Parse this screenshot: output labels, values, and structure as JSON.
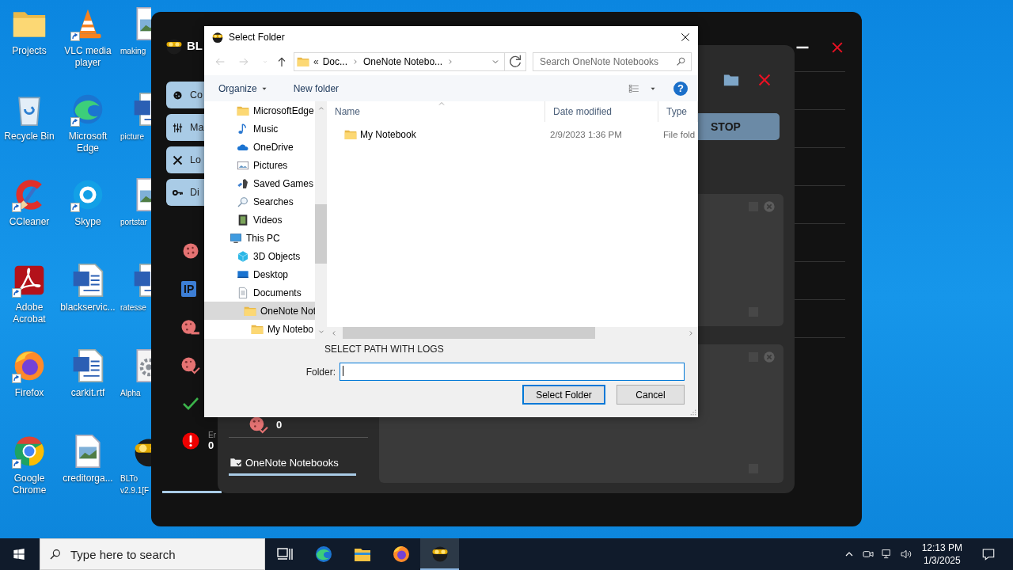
{
  "desktop_icons": [
    {
      "label": "Projects",
      "kind": "folder",
      "shortcut": false
    },
    {
      "label": "VLC media player",
      "kind": "cone",
      "shortcut": true
    },
    {
      "label": "making",
      "kind": "imagefile",
      "shortcut": false
    },
    {
      "label": "Recycle Bin",
      "kind": "bin",
      "shortcut": false
    },
    {
      "label": "Microsoft Edge",
      "kind": "swirl",
      "shortcut": true
    },
    {
      "label": "picture",
      "kind": "worddoc",
      "shortcut": false
    },
    {
      "label": "CCleaner",
      "kind": "ccleaner",
      "shortcut": true
    },
    {
      "label": "Skype",
      "kind": "skype",
      "shortcut": true
    },
    {
      "label": "portstar",
      "kind": "imagefile",
      "shortcut": false
    },
    {
      "label": "Adobe Acrobat",
      "kind": "acrobat",
      "shortcut": true
    },
    {
      "label": "blackservic...",
      "kind": "worddoc",
      "shortcut": false
    },
    {
      "label": "ratesse",
      "kind": "worddoc",
      "shortcut": false
    },
    {
      "label": "Firefox",
      "kind": "firefox",
      "shortcut": true
    },
    {
      "label": "carkit.rtf",
      "kind": "worddoc",
      "shortcut": false
    },
    {
      "label": "Alpha",
      "kind": "gearfile",
      "shortcut": false
    },
    {
      "label": "Google Chrome",
      "kind": "chrome",
      "shortcut": true
    },
    {
      "label": "creditorga...",
      "kind": "imagefile",
      "shortcut": false
    },
    {
      "label": "BLTo v2.9.1[F",
      "kind": "goggles",
      "shortcut": false
    }
  ],
  "app": {
    "title": "BL",
    "nav": [
      {
        "label": "Co",
        "kind": "cookie"
      },
      {
        "label": "Ma",
        "kind": "sliders"
      },
      {
        "label": "Lo",
        "kind": "tools"
      },
      {
        "label": "Di",
        "kind": "key"
      }
    ],
    "stats": [
      {
        "kind": "cookie"
      },
      {
        "kind": "ip",
        "label": "IP"
      },
      {
        "kind": "cookieminus"
      },
      {
        "kind": "cookiecheck"
      },
      {
        "kind": "check"
      },
      {
        "kind": "error",
        "label": "Er",
        "value": "0"
      }
    ],
    "stop_label": "STOP",
    "panel_stat": {
      "kind": "cookiecheck",
      "value": "0"
    },
    "folder_tab": {
      "label": "OneNote Notebooks",
      "selected": true
    }
  },
  "dialog": {
    "title": "Select Folder",
    "nav": [
      {
        "kind": "back",
        "disabled": true
      },
      {
        "kind": "forward",
        "disabled": true
      },
      {
        "kind": "recent",
        "disabled": true
      },
      {
        "kind": "up",
        "disabled": false
      }
    ],
    "address": {
      "overflow": "«",
      "crumbs": [
        "Doc...",
        "OneNote Notebo..."
      ]
    },
    "search": {
      "placeholder": "Search OneNote Notebooks"
    },
    "toolbar": {
      "organize": "Organize",
      "new_folder": "New folder",
      "help": "?"
    },
    "tree": {
      "upper": [
        {
          "label": "MicrosoftEdge",
          "kind": "folder",
          "selected": false
        },
        {
          "label": "Music",
          "kind": "music",
          "selected": false
        },
        {
          "label": "OneDrive",
          "kind": "cloud",
          "selected": false
        },
        {
          "label": "Pictures",
          "kind": "pictures",
          "selected": false
        },
        {
          "label": "Saved Games",
          "kind": "games",
          "selected": false
        },
        {
          "label": "Searches",
          "kind": "searchtree",
          "selected": false
        },
        {
          "label": "Videos",
          "kind": "video",
          "selected": false
        }
      ],
      "items": [
        {
          "label": "This PC",
          "kind": "pc",
          "selected": false,
          "children": [
            {
              "label": "3D Objects",
              "kind": "cube",
              "selected": false
            },
            {
              "label": "Desktop",
              "kind": "desktop",
              "selected": false
            },
            {
              "label": "Documents",
              "kind": "docs",
              "selected": false,
              "children": [
                {
                  "label": "OneNote Not",
                  "kind": "folder",
                  "selected": true,
                  "children": [
                    {
                      "label": "My Notebo",
                      "kind": "folder",
                      "selected": false
                    }
                  ]
                }
              ]
            }
          ]
        }
      ]
    },
    "columns": [
      "Name",
      "Date modified",
      "Type"
    ],
    "rows": [
      {
        "name": "My Notebook",
        "date": "2/9/2023 1:36 PM",
        "type": "File fold",
        "selected": false
      }
    ],
    "description": "SELECT PATH WITH LOGS",
    "folder_field": {
      "label": "Folder:",
      "focused": true
    },
    "buttons": [
      {
        "label": "Select Folder",
        "default": true
      },
      {
        "label": "Cancel",
        "default": false
      }
    ]
  },
  "taskbar": {
    "search": {
      "placeholder": "Type here to search"
    },
    "apps": [
      {
        "kind": "taskview",
        "selected": false
      },
      {
        "kind": "swirl",
        "selected": false
      },
      {
        "kind": "explorer",
        "selected": false
      },
      {
        "kind": "firefox",
        "selected": false
      },
      {
        "kind": "goggles",
        "selected": true
      }
    ],
    "tray": [
      {
        "kind": "chevup"
      },
      {
        "kind": "camera"
      },
      {
        "kind": "network"
      },
      {
        "kind": "speaker"
      }
    ],
    "time": "12:13 PM",
    "date": "1/3/2025"
  }
}
